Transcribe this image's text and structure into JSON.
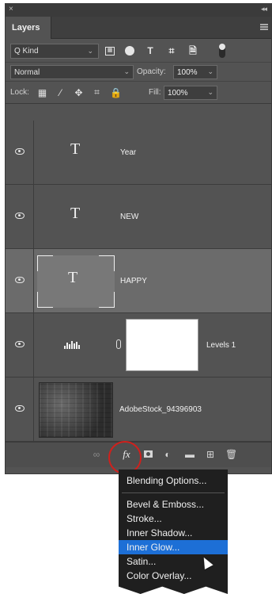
{
  "panel": {
    "tab_label": "Layers",
    "close_glyph": "×",
    "collapse_glyph": "◂◂"
  },
  "filter": {
    "kind_value": "Q Kind",
    "icons": [
      "image-filter-icon",
      "adjustment-filter-icon",
      "type-filter-icon",
      "shape-filter-icon",
      "smart-object-filter-icon"
    ]
  },
  "blend": {
    "mode_value": "Normal",
    "opacity_label": "Opacity:",
    "opacity_value": "100%"
  },
  "lock": {
    "label": "Lock:",
    "fill_label": "Fill:",
    "fill_value": "100%"
  },
  "layers": [
    {
      "name": "Year",
      "type": "text",
      "selected": false,
      "visible": true
    },
    {
      "name": "NEW",
      "type": "text",
      "selected": false,
      "visible": true
    },
    {
      "name": "HAPPY",
      "type": "text",
      "selected": true,
      "visible": true
    },
    {
      "name": "Levels 1",
      "type": "adjustment",
      "selected": false,
      "visible": true
    },
    {
      "name": "AdobeStock_94396903",
      "type": "image",
      "selected": false,
      "visible": true
    }
  ],
  "bottom_bar": {
    "fx_label": "fx",
    "buttons": [
      "link-layers-icon",
      "add-style-fx-icon",
      "add-mask-icon",
      "adjustment-layer-icon",
      "new-group-folder-icon",
      "new-layer-icon",
      "trash-icon"
    ]
  },
  "fx_menu": {
    "items": [
      {
        "label": "Blending Options...",
        "highlight": false
      },
      {
        "label": "Bevel & Emboss...",
        "highlight": false
      },
      {
        "label": "Stroke...",
        "highlight": false
      },
      {
        "label": "Inner Shadow...",
        "highlight": false
      },
      {
        "label": "Inner Glow...",
        "highlight": true
      },
      {
        "label": "Satin...",
        "highlight": false
      },
      {
        "label": "Color Overlay...",
        "highlight": false
      }
    ],
    "highlight_color": "#1d6fd6"
  },
  "colors": {
    "panel_bg": "#535353",
    "selected_layer": "#6b6b6b",
    "highlight_circle": "#d0201c"
  }
}
